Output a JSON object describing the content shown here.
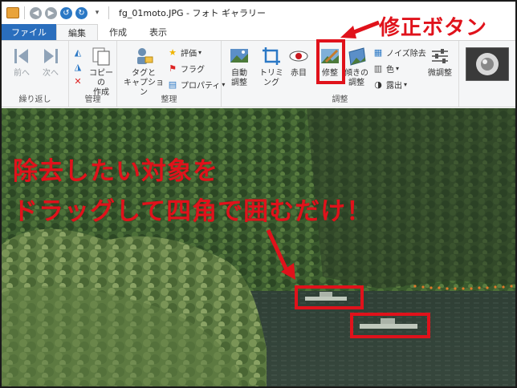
{
  "window": {
    "title": "fg_01moto.JPG - フォト ギャラリー"
  },
  "tabs": [
    {
      "label": "ファイル"
    },
    {
      "label": "編集"
    },
    {
      "label": "作成"
    },
    {
      "label": "表示"
    }
  ],
  "ribbon": {
    "groups": {
      "undo": {
        "label": "繰り返し",
        "prev": "前へ",
        "next": "次へ"
      },
      "manage": {
        "label": "管理",
        "copy": "コピーの\n作成"
      },
      "organize": {
        "label": "整理",
        "tag": "タグと\nキャプション",
        "rating": "評価",
        "flag": "フラグ",
        "properties": "プロパティ"
      },
      "adjust": {
        "label": "調整",
        "auto_adjust": "自動\n調整",
        "crop": "トリミ\nング",
        "redeye": "赤目",
        "retouch": "修整",
        "straighten": "傾きの\n調整",
        "noise": "ノイズ除去",
        "color": "色",
        "exposure": "露出",
        "fine_tune": "微調整"
      }
    }
  },
  "annotations": {
    "button_callout": "修正ボタン",
    "instruction_line1": "除去したい対象を",
    "instruction_line2": "ドラッグして四角で囲むだけ！"
  },
  "colors": {
    "accent_red": "#e0121b",
    "file_tab_blue": "#2a6ebd"
  }
}
